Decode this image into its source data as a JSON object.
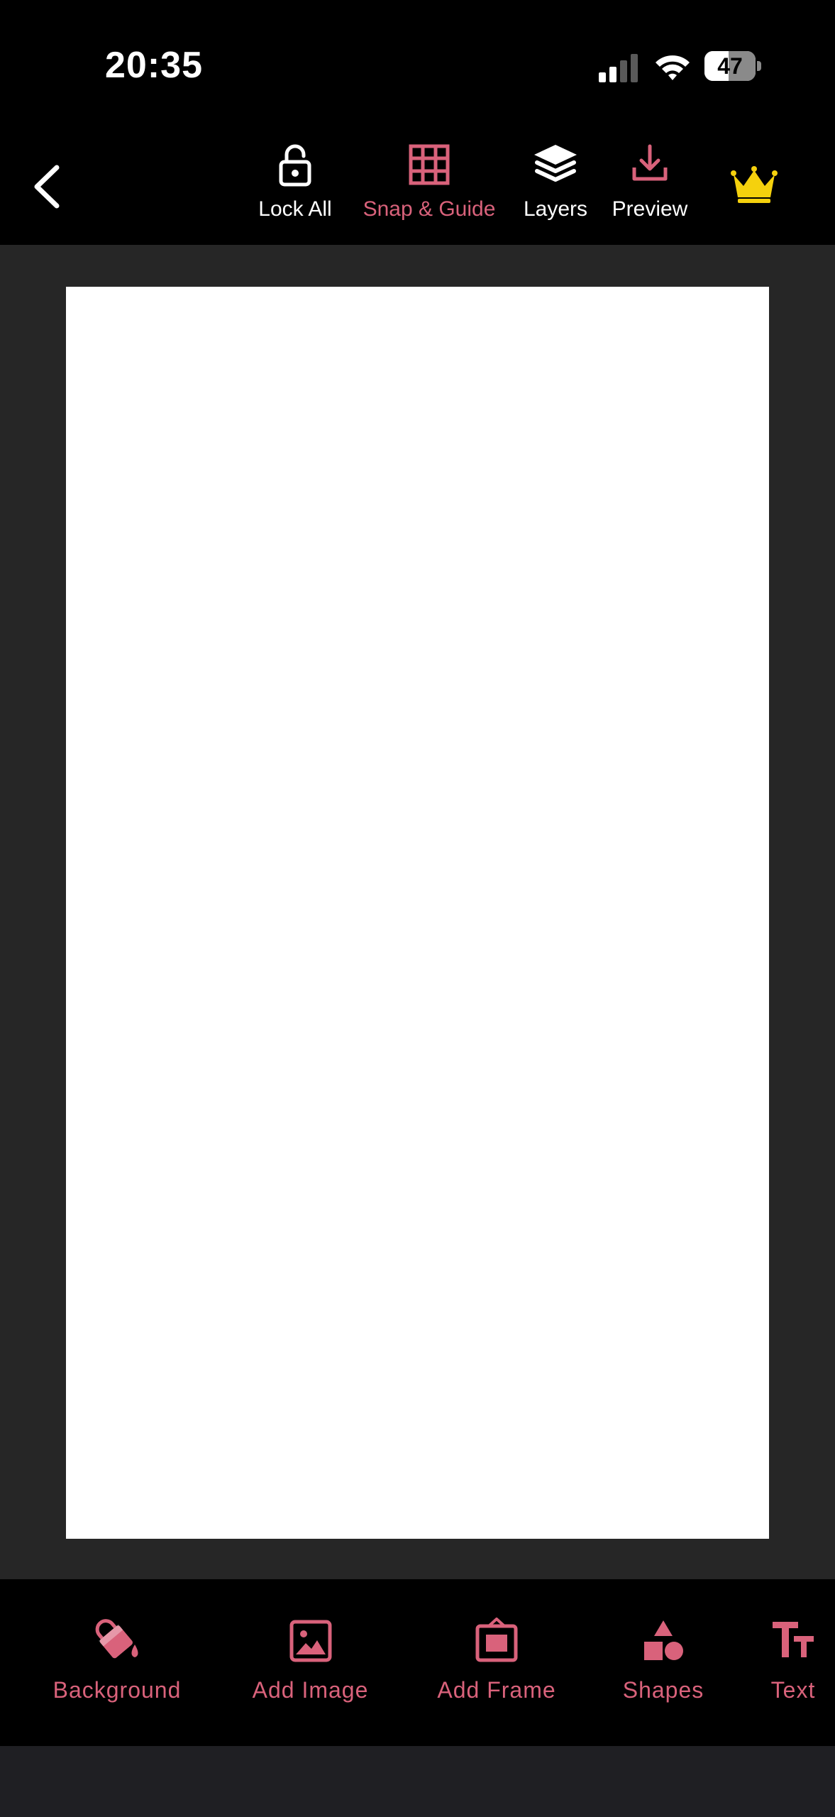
{
  "status_bar": {
    "time": "20:35",
    "battery_level": "47",
    "battery_fraction": 0.47,
    "signal_bars_active": 2,
    "signal_bars_total": 4
  },
  "toolbar": {
    "back_icon": "chevron-left-icon",
    "tools": [
      {
        "label": "Lock All",
        "icon": "unlock-icon",
        "active": false
      },
      {
        "label": "Snap & Guide",
        "icon": "grid-icon",
        "active": true
      },
      {
        "label": "Layers",
        "icon": "layers-icon",
        "active": false
      },
      {
        "label": "Preview",
        "icon": "download-icon",
        "active": false
      }
    ],
    "premium_icon": "crown-icon"
  },
  "canvas": {
    "background": "#ffffff"
  },
  "bottom_toolbar": {
    "items": [
      {
        "label": "Background",
        "icon": "paint-bucket-icon"
      },
      {
        "label": "Add Image",
        "icon": "image-icon"
      },
      {
        "label": "Add Frame",
        "icon": "frame-icon"
      },
      {
        "label": "Shapes",
        "icon": "shapes-icon"
      },
      {
        "label": "Text",
        "icon": "text-icon"
      }
    ]
  },
  "colors": {
    "accent": "#d9627b",
    "crown": "#f5d10d",
    "toolbar_bg": "#000000",
    "workspace_bg": "#262626"
  }
}
